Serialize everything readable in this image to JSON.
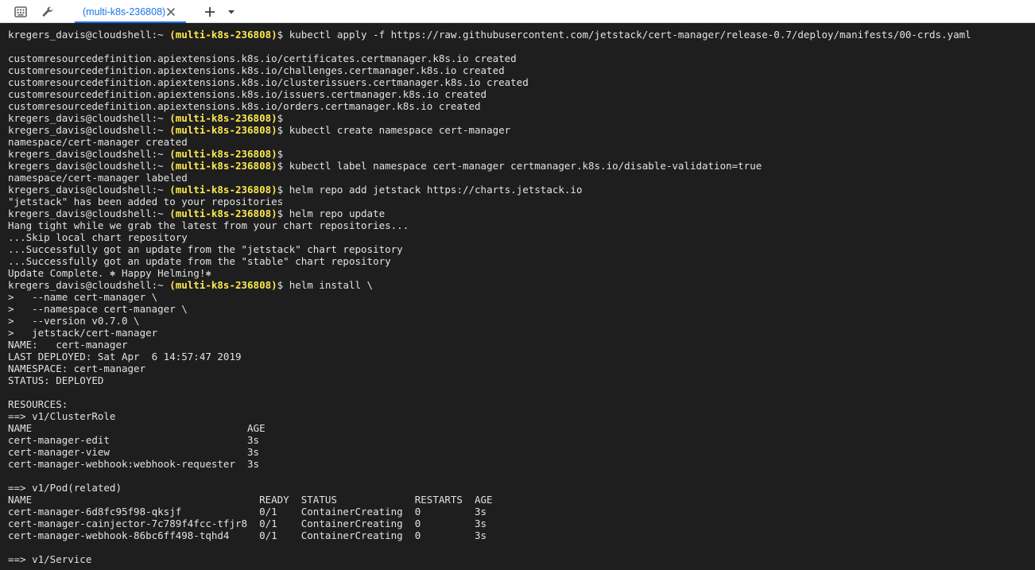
{
  "toolbar": {
    "tab_label": "(multi-k8s-236808)",
    "icons": [
      "keyboard-icon",
      "wrench-icon",
      "close-icon",
      "plus-icon",
      "caret-down-icon"
    ]
  },
  "colors": {
    "accent": "#1a73e8",
    "terminal_bg": "#1e1e1e",
    "terminal_fg": "#e2e2e2",
    "project": "#fce94f"
  },
  "terminal": {
    "lines": [
      {
        "prompt": "kregers_davis@cloudshell:~ ",
        "project": "(multi-k8s-236808)",
        "cmd": "$ kubectl apply -f https://raw.githubusercontent.com/jetstack/cert-manager/release-0.7/deploy/manifests/00-crds.yaml"
      },
      {
        "text": ""
      },
      {
        "text": "customresourcedefinition.apiextensions.k8s.io/certificates.certmanager.k8s.io created"
      },
      {
        "text": "customresourcedefinition.apiextensions.k8s.io/challenges.certmanager.k8s.io created"
      },
      {
        "text": "customresourcedefinition.apiextensions.k8s.io/clusterissuers.certmanager.k8s.io created"
      },
      {
        "text": "customresourcedefinition.apiextensions.k8s.io/issuers.certmanager.k8s.io created"
      },
      {
        "text": "customresourcedefinition.apiextensions.k8s.io/orders.certmanager.k8s.io created"
      },
      {
        "prompt": "kregers_davis@cloudshell:~ ",
        "project": "(multi-k8s-236808)",
        "cmd": "$"
      },
      {
        "prompt": "kregers_davis@cloudshell:~ ",
        "project": "(multi-k8s-236808)",
        "cmd": "$ kubectl create namespace cert-manager"
      },
      {
        "text": "namespace/cert-manager created"
      },
      {
        "prompt": "kregers_davis@cloudshell:~ ",
        "project": "(multi-k8s-236808)",
        "cmd": "$"
      },
      {
        "prompt": "kregers_davis@cloudshell:~ ",
        "project": "(multi-k8s-236808)",
        "cmd": "$ kubectl label namespace cert-manager certmanager.k8s.io/disable-validation=true"
      },
      {
        "text": "namespace/cert-manager labeled"
      },
      {
        "prompt": "kregers_davis@cloudshell:~ ",
        "project": "(multi-k8s-236808)",
        "cmd": "$ helm repo add jetstack https://charts.jetstack.io"
      },
      {
        "text": "\"jetstack\" has been added to your repositories"
      },
      {
        "prompt": "kregers_davis@cloudshell:~ ",
        "project": "(multi-k8s-236808)",
        "cmd": "$ helm repo update"
      },
      {
        "text": "Hang tight while we grab the latest from your chart repositories..."
      },
      {
        "text": "...Skip local chart repository"
      },
      {
        "text": "...Successfully got an update from the \"jetstack\" chart repository"
      },
      {
        "text": "...Successfully got an update from the \"stable\" chart repository"
      },
      {
        "text": "Update Complete. ⎈ Happy Helming!⎈"
      },
      {
        "prompt": "kregers_davis@cloudshell:~ ",
        "project": "(multi-k8s-236808)",
        "cmd": "$ helm install \\"
      },
      {
        "text": ">   --name cert-manager \\"
      },
      {
        "text": ">   --namespace cert-manager \\"
      },
      {
        "text": ">   --version v0.7.0 \\"
      },
      {
        "text": ">   jetstack/cert-manager"
      },
      {
        "text": "NAME:   cert-manager"
      },
      {
        "text": "LAST DEPLOYED: Sat Apr  6 14:57:47 2019"
      },
      {
        "text": "NAMESPACE: cert-manager"
      },
      {
        "text": "STATUS: DEPLOYED"
      },
      {
        "text": ""
      },
      {
        "text": "RESOURCES:"
      },
      {
        "text": "==> v1/ClusterRole"
      },
      {
        "text": "NAME                                    AGE"
      },
      {
        "text": "cert-manager-edit                       3s"
      },
      {
        "text": "cert-manager-view                       3s"
      },
      {
        "text": "cert-manager-webhook:webhook-requester  3s"
      },
      {
        "text": ""
      },
      {
        "text": "==> v1/Pod(related)"
      },
      {
        "text": "NAME                                      READY  STATUS             RESTARTS  AGE"
      },
      {
        "text": "cert-manager-6d8fc95f98-qksjf             0/1    ContainerCreating  0         3s"
      },
      {
        "text": "cert-manager-cainjector-7c789f4fcc-tfjr8  0/1    ContainerCreating  0         3s"
      },
      {
        "text": "cert-manager-webhook-86bc6ff498-tqhd4     0/1    ContainerCreating  0         3s"
      },
      {
        "text": ""
      },
      {
        "text": "==> v1/Service"
      }
    ]
  }
}
